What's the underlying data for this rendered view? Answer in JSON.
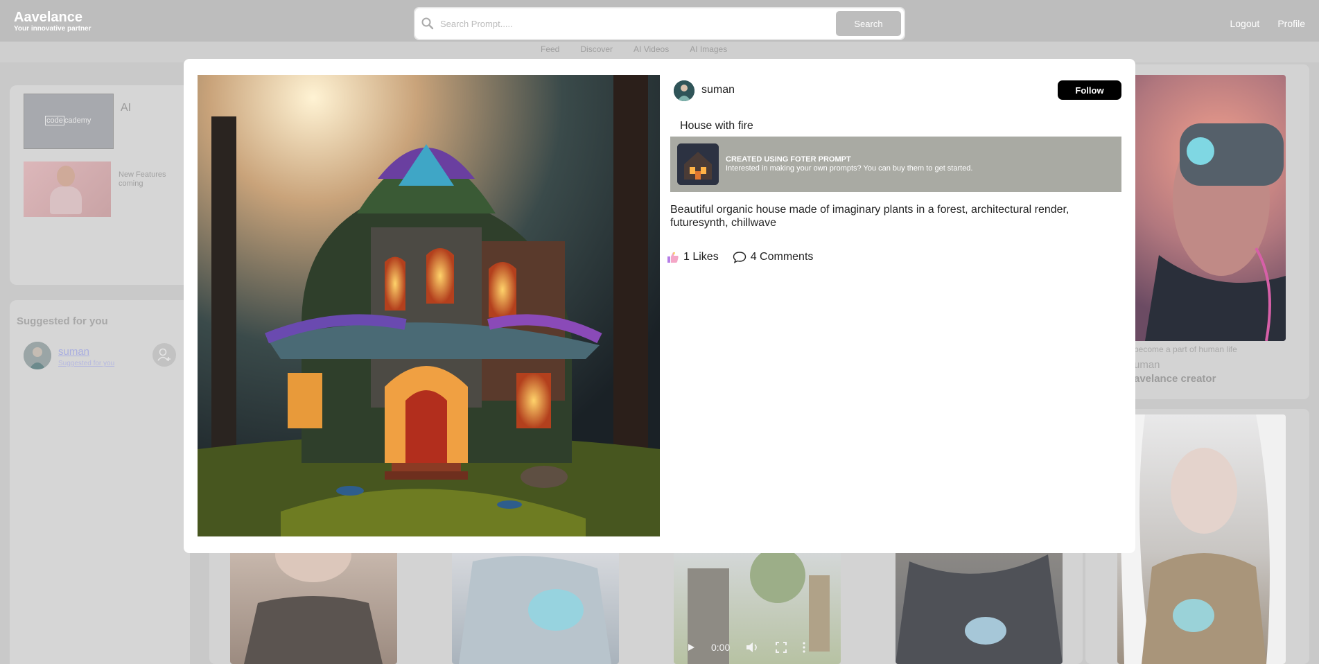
{
  "header": {
    "brand_name": "Aavelance",
    "brand_tagline": "Your innovative partner",
    "search_placeholder": "Search Prompt.....",
    "search_button": "Search",
    "logout": "Logout",
    "profile": "Profile"
  },
  "nav": {
    "tabs": [
      {
        "label": "Feed"
      },
      {
        "label": "Discover"
      },
      {
        "label": "AI Videos"
      },
      {
        "label": "AI Images"
      }
    ]
  },
  "sidebar": {
    "ad_logo_left": "code",
    "ad_logo_right": "cademy",
    "ad_label": "AI",
    "ad_sub": "New Features coming",
    "suggest_title": "Suggested for you",
    "suggest_user": {
      "name": "suman",
      "subtitle": "Suggested for you"
    }
  },
  "feed": {
    "right_card_caption": "become a part of human life",
    "right_card_user": "uman",
    "right_card_role": "avelance creator",
    "video_time": "0:00"
  },
  "modal": {
    "creator": "suman",
    "follow": "Follow",
    "title": "House with fire",
    "promo_heading": "CREATED USING FOTER PROMPT",
    "promo_text": "Interested in making your own prompts? You can buy them to get started.",
    "description": "Beautiful organic house made of imaginary plants in a forest, architectural render, futuresynth, chillwave",
    "likes": "1 Likes",
    "comments": "4 Comments"
  },
  "icons": {
    "search": "search-icon",
    "like": "thumbs-up-icon",
    "comment": "speech-bubble-icon",
    "add_user": "add-user-icon",
    "play": "play-icon",
    "volume": "volume-icon",
    "fullscreen": "fullscreen-icon",
    "more": "more-vertical-icon"
  },
  "colors": {
    "header_bg": "#bdbdbd",
    "overlay_bg": "#c9c9c9",
    "follow_bg": "#000000",
    "promo_bg": "#a9aaa3"
  }
}
